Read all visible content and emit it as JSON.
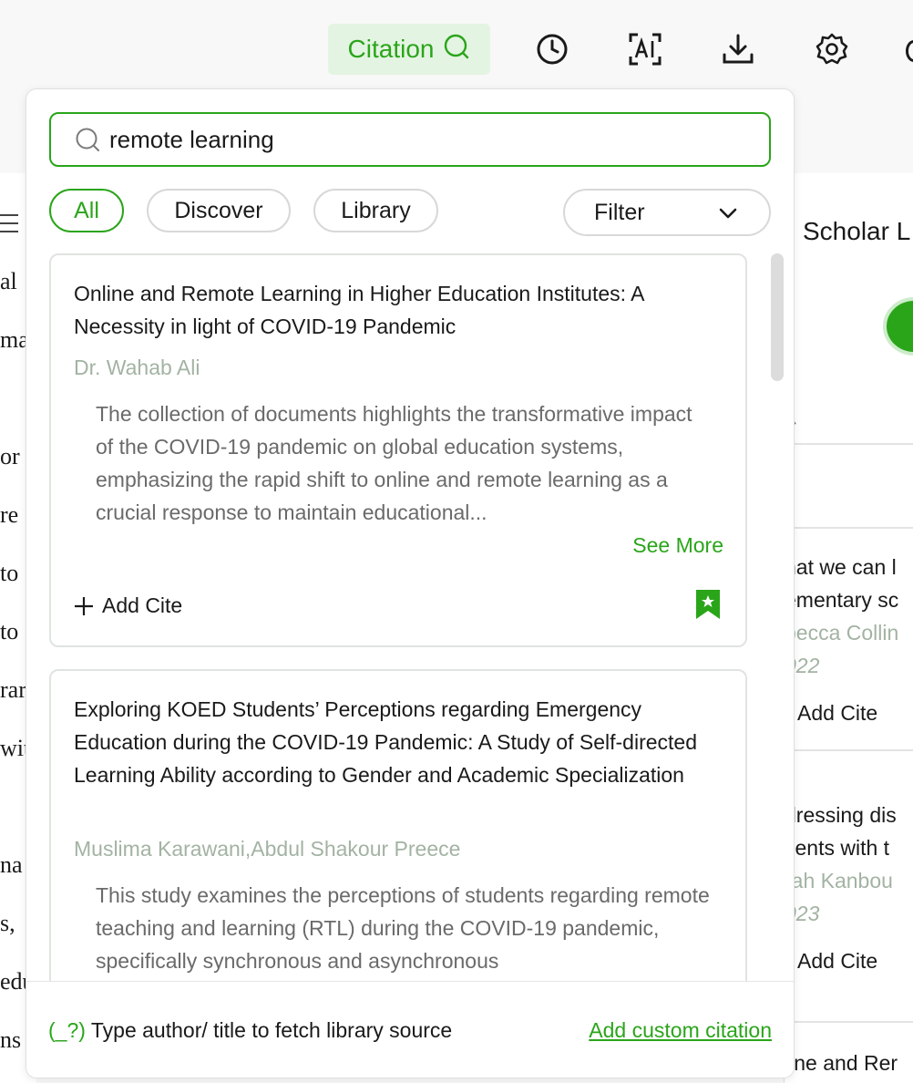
{
  "toolbar": {
    "citation_label": "Citation",
    "icons": [
      "search-icon",
      "history-icon",
      "ai-icon",
      "download-icon",
      "settings-icon"
    ]
  },
  "search": {
    "value": "remote learning",
    "placeholder": "Search"
  },
  "tabs": [
    {
      "label": "All",
      "active": true
    },
    {
      "label": "Discover",
      "active": false
    },
    {
      "label": "Library",
      "active": false
    }
  ],
  "filter": {
    "label": "Filter"
  },
  "results": [
    {
      "title": "Online and Remote Learning in Higher Education Institutes: A Necessity in light of COVID-19 Pandemic",
      "authors": "Dr. Wahab Ali",
      "summary": "The collection of documents highlights the transformative impact of the COVID-19 pandemic on global education systems, emphasizing the rapid shift to online and remote learning as a crucial response to maintain educational...",
      "see_more": "See More",
      "add_cite": "Add Cite",
      "bookmarked": true
    },
    {
      "title": "Exploring KOED Students’ Perceptions regarding Emergency Education during the COVID-19 Pandemic: A Study of Self-directed Learning Ability according to Gender and Academic Specialization",
      "authors": "Muslima Karawani,Abdul Shakour Preece",
      "summary": "This study examines the perceptions of students regarding remote teaching and learning (RTL) during the COVID-19 pandemic, specifically synchronous and asynchronous"
    }
  ],
  "footer": {
    "hint_symbol": "(_?)",
    "hint_text": "Type author/ title to fetch library source",
    "custom_link": "Add custom citation"
  },
  "background_doc": {
    "fragments": [
      "al",
      "ma",
      "or",
      "re",
      "to",
      "to",
      "rar",
      "wit",
      "na",
      "s,",
      "edu",
      "ns"
    ]
  },
  "right_panel": {
    "heading": "Scholar L",
    "items": [
      {
        "line1": "hat we can l",
        "line2": "ementary sc",
        "author": "becca Collin",
        "year": "022",
        "add_cite": "Add Cite"
      },
      {
        "line1": "dressing dis",
        "line2": "tients with t",
        "author": "rah Kanbou",
        "year": "023",
        "add_cite": "Add Cite"
      },
      {
        "line1": "line and Rer"
      }
    ]
  },
  "colors": {
    "accent": "#2aa51a",
    "accent_bg": "#e4f4e2",
    "muted_author": "#a3b3a3"
  }
}
